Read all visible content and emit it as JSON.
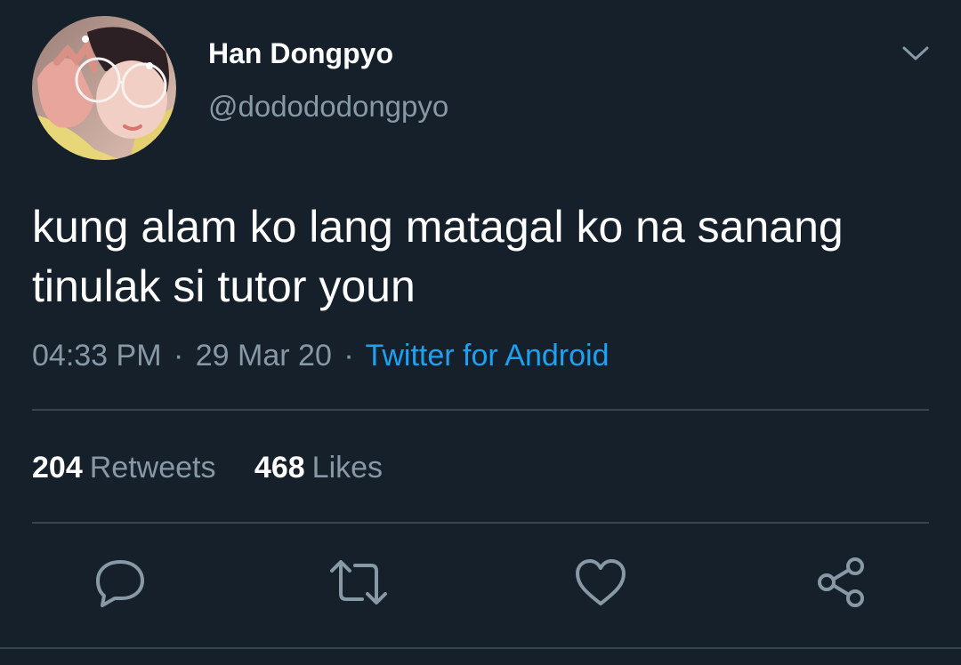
{
  "tweet": {
    "author": {
      "display_name": "Han Dongpyo",
      "handle": "@dodododongpyo"
    },
    "text_lines": [
      "kung alam ko lang matagal ko na sanang",
      "tinulak si tutor youn"
    ],
    "meta": {
      "time": "04:33 PM",
      "separator": "·",
      "date": "29 Mar 20",
      "source": "Twitter for Android"
    },
    "stats": {
      "retweets_count": "204",
      "retweets_label": "Retweets",
      "likes_count": "468",
      "likes_label": "Likes"
    }
  },
  "icons": {
    "menu": "chevron-down-icon",
    "reply": "reply-icon",
    "retweet": "retweet-icon",
    "like": "heart-icon",
    "share": "share-icon"
  },
  "colors": {
    "background": "#15202b",
    "primary_text": "#ffffff",
    "secondary_text": "#8899a6",
    "link": "#1da1f2",
    "divider": "#38444d"
  }
}
